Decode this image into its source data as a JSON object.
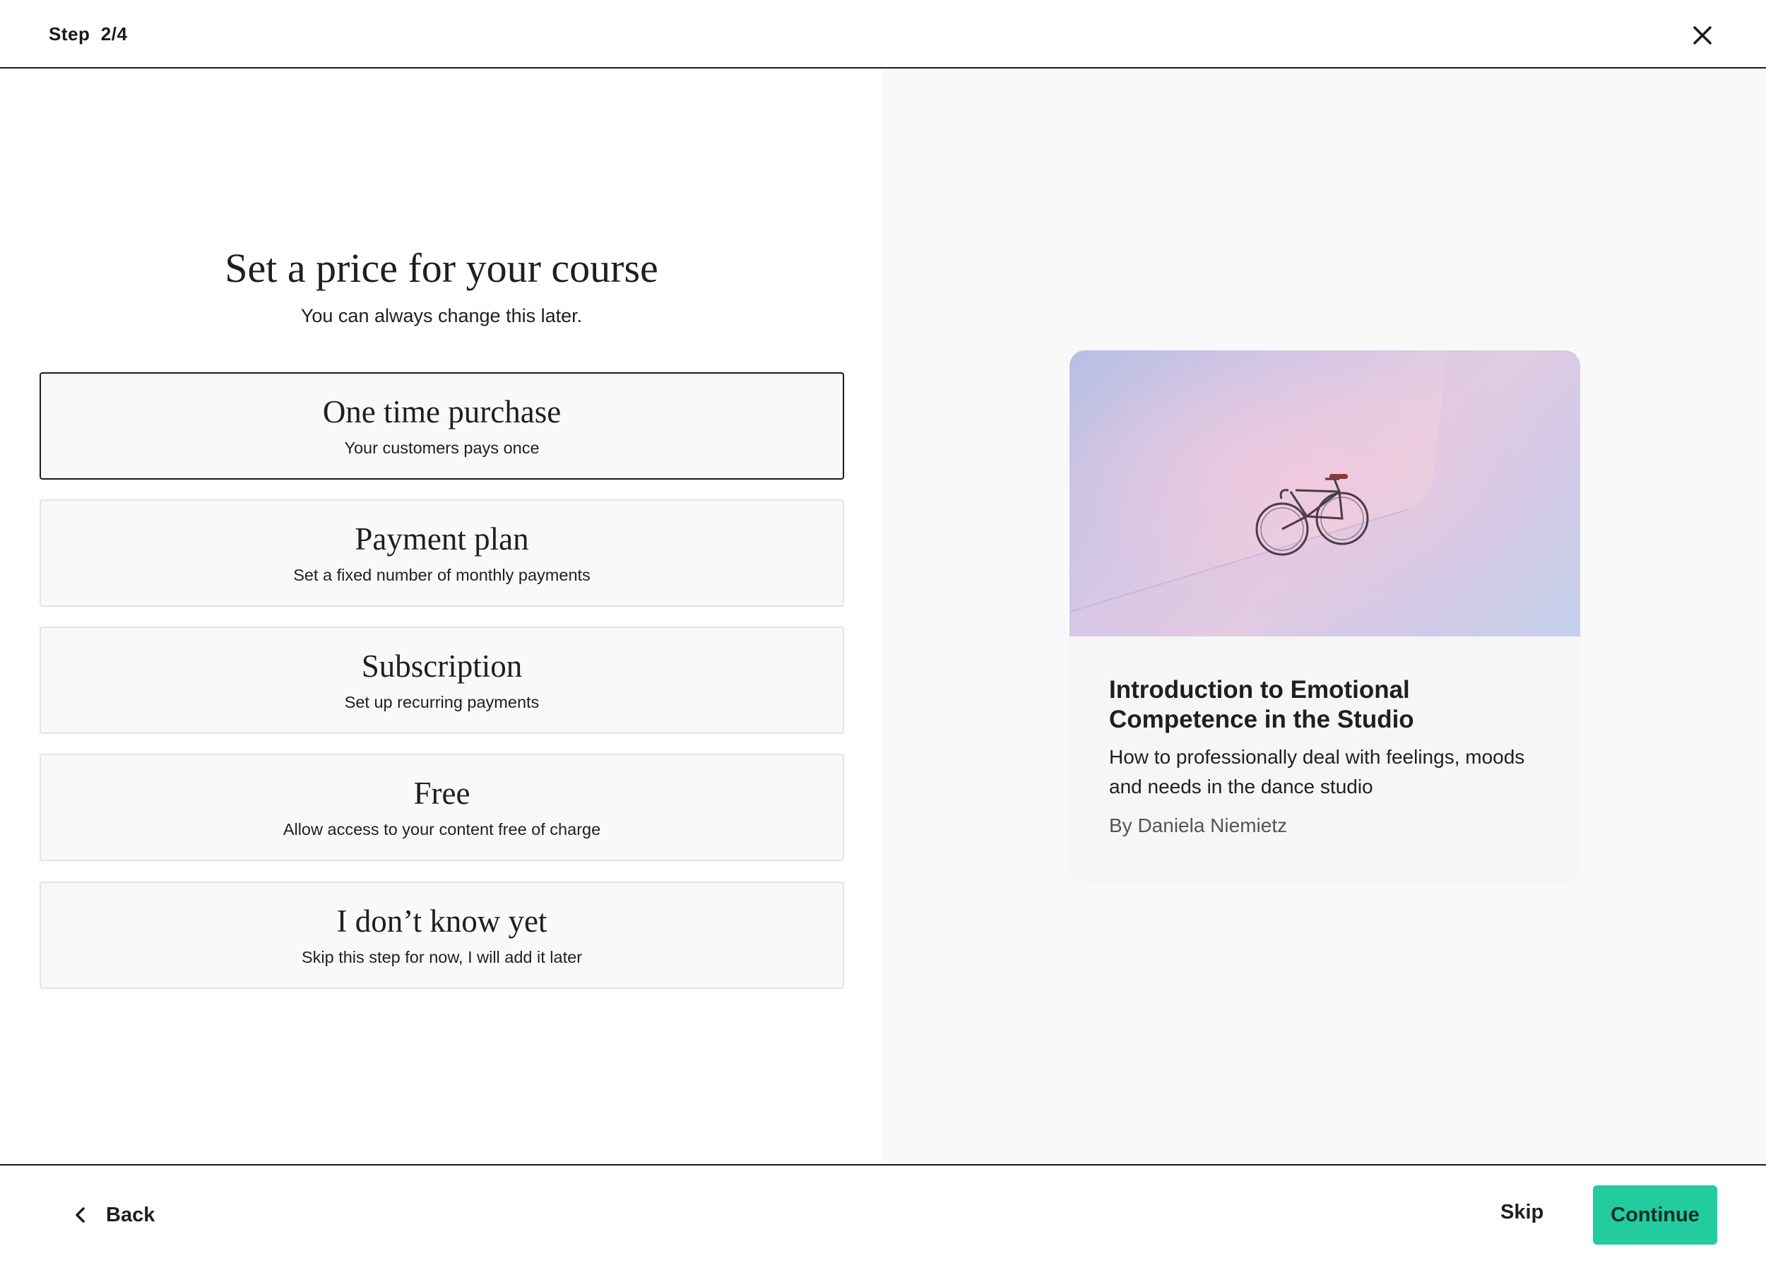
{
  "header": {
    "step_label": "Step  2/4"
  },
  "main": {
    "title": "Set a price for your course",
    "subtitle": "You can always change this later.",
    "options": [
      {
        "title": "One time purchase",
        "description": "Your customers pays once",
        "selected": true
      },
      {
        "title": "Payment plan",
        "description": "Set a fixed number of monthly payments",
        "selected": false
      },
      {
        "title": "Subscription",
        "description": "Set up recurring payments",
        "selected": false
      },
      {
        "title": "Free",
        "description": "Allow access to your content free of charge",
        "selected": false
      },
      {
        "title": "I don’t know yet",
        "description": "Skip this step for now, I will add it later",
        "selected": false
      }
    ]
  },
  "preview": {
    "title": "Introduction to Emotional Competence in the Studio",
    "description": "How to professionally deal with feelings, moods and needs in the dance studio",
    "author": "By Daniela Niemietz"
  },
  "footer": {
    "back_label": "Back",
    "skip_label": "Skip",
    "continue_label": "Continue"
  },
  "colors": {
    "accent": "#22cc9e",
    "right_panel_bg": "#f9f9f9"
  }
}
